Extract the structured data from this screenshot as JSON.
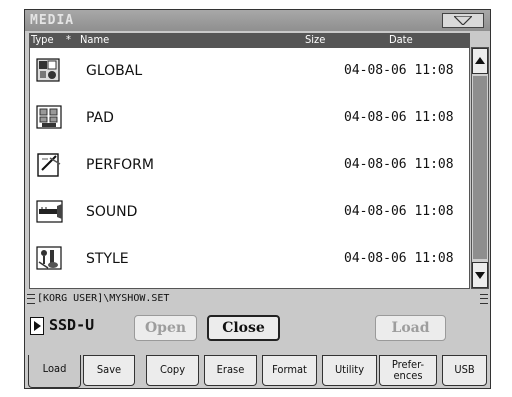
{
  "window": {
    "title": "MEDIA",
    "menu_icon": "triangle-down-icon"
  },
  "columns": {
    "type": "Type",
    "star": "*",
    "name": "Name",
    "size": "Size",
    "date": "Date"
  },
  "files": [
    {
      "name": "GLOBAL",
      "size": "",
      "date": "04-08-06 11:08",
      "icon": "global-file-icon"
    },
    {
      "name": "PAD",
      "size": "",
      "date": "04-08-06 11:08",
      "icon": "pad-file-icon"
    },
    {
      "name": "PERFORM",
      "size": "",
      "date": "04-08-06 11:08",
      "icon": "perform-file-icon"
    },
    {
      "name": "SOUND",
      "size": "",
      "date": "04-08-06 11:08",
      "icon": "sound-file-icon"
    },
    {
      "name": "STYLE",
      "size": "",
      "date": "04-08-06 11:08",
      "icon": "style-file-icon"
    }
  ],
  "path": "[KORG USER]\\MYSHOW.SET",
  "device": "SSD-U",
  "buttons": {
    "open": "Open",
    "close": "Close",
    "load": "Load"
  },
  "tabs": [
    {
      "label": "Load",
      "selected": true
    },
    {
      "label": "Save"
    },
    {
      "label": "Copy"
    },
    {
      "label": "Erase"
    },
    {
      "label": "Format"
    },
    {
      "label": "Utility"
    },
    {
      "label": "Prefer-\nences"
    },
    {
      "label": "USB"
    }
  ]
}
